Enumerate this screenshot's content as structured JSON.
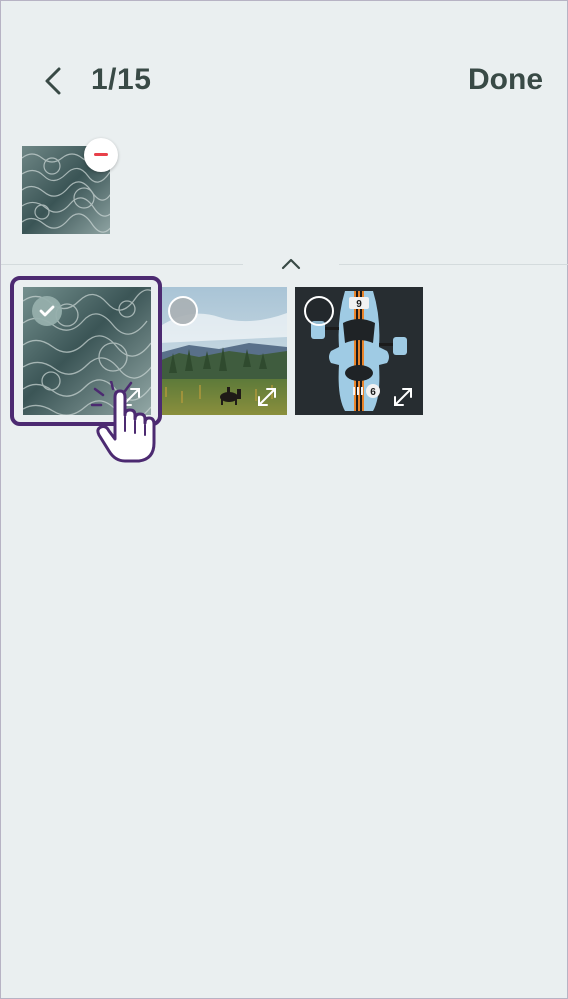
{
  "header": {
    "back_icon": "chevron-left-icon",
    "counter": "1/15",
    "done_label": "Done"
  },
  "selected": {
    "items": [
      {
        "image": "water-ripples-photo",
        "remove_icon": "minus-circle-icon"
      }
    ]
  },
  "collapse_icon": "chevron-up-icon",
  "gallery": {
    "items": [
      {
        "image": "water-ripples-photo",
        "selected": true,
        "check_icon": "checkmark-icon",
        "expand_icon": "expand-icon"
      },
      {
        "image": "landscape-horse-photo",
        "selected": false,
        "expand_icon": "expand-icon"
      },
      {
        "image": "race-car-top-view-photo",
        "selected": false,
        "expand_icon": "expand-icon"
      }
    ]
  },
  "pointer_icon": "hand-pointer-icon",
  "colors": {
    "background": "#eaeff0",
    "text": "#394a46",
    "focus_ring": "#4c2a71",
    "remove": "#e8404a"
  }
}
